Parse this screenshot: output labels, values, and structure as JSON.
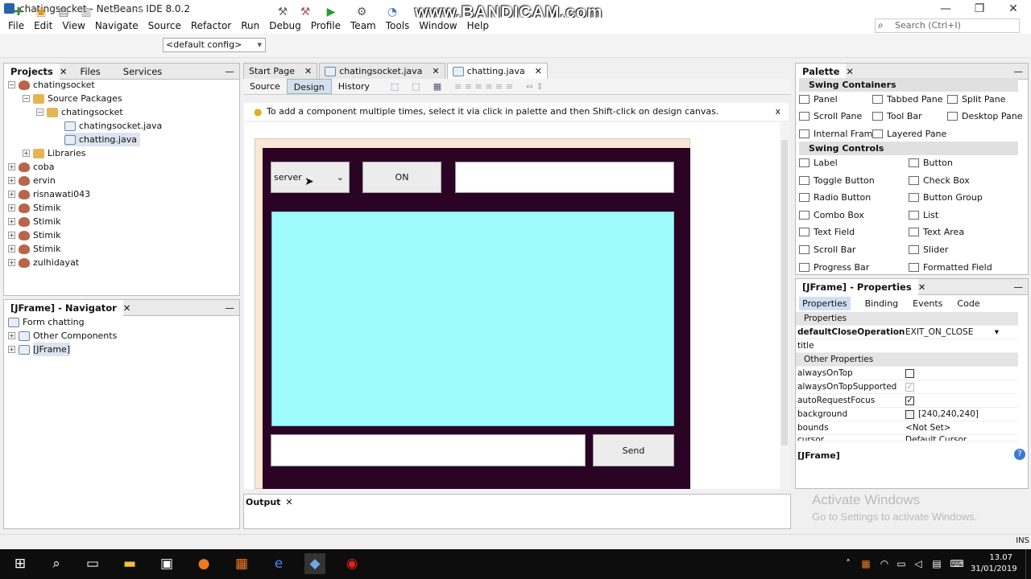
{
  "window": {
    "title": "chatingsocket - NetBeans IDE 8.0.2",
    "watermark": "www.BANDICAM.com"
  },
  "menu": [
    "File",
    "Edit",
    "View",
    "Navigate",
    "Source",
    "Refactor",
    "Run",
    "Debug",
    "Profile",
    "Team",
    "Tools",
    "Window",
    "Help"
  ],
  "toolbar": {
    "config": "<default config>",
    "search_placeholder": "Search (Ctrl+I)"
  },
  "projects": {
    "tabs": [
      "Projects",
      "Files",
      "Services"
    ],
    "tree": [
      "chatingsocket",
      "Source Packages",
      "chatingsocket",
      "chatingsocket.java",
      "chatting.java",
      "Libraries",
      "coba",
      "ervin",
      "risnawati043",
      "Stimik",
      "Stimik",
      "Stimik",
      "Stimik",
      "zulhidayat"
    ]
  },
  "navigator": {
    "title": "[JFrame] - Navigator",
    "tree": [
      "Form chatting",
      "Other Components",
      "[JFrame]"
    ]
  },
  "editor": {
    "tabs": [
      "Start Page",
      "chatingsocket.java",
      "chatting.java"
    ],
    "modes": [
      "Source",
      "Design",
      "History"
    ],
    "hint": "To add a component multiple times, select it via click in palette and then Shift-click on design canvas.",
    "hint_close": "x",
    "form": {
      "combo_value": "server",
      "on_button": "ON",
      "send_button": "Send"
    },
    "colors": {
      "frame_bg": "#2a0325",
      "textarea_bg": "#9efcfc"
    }
  },
  "output": {
    "title": "Output"
  },
  "palette": {
    "title": "Palette",
    "sections": {
      "containers": {
        "label": "Swing Containers",
        "items": [
          "Panel",
          "Tabbed Pane",
          "Split Pane",
          "Scroll Pane",
          "Tool Bar",
          "Desktop Pane",
          "Internal Frame",
          "Layered Pane"
        ]
      },
      "controls": {
        "label": "Swing Controls",
        "items": [
          "Label",
          "Button",
          "Toggle Button",
          "Check Box",
          "Radio Button",
          "Button Group",
          "Combo Box",
          "List",
          "Text Field",
          "Text Area",
          "Scroll Bar",
          "Slider",
          "Progress Bar",
          "Formatted Field"
        ]
      }
    }
  },
  "properties": {
    "title": "[JFrame] - Properties",
    "tabs": [
      "Properties",
      "Binding",
      "Events",
      "Code"
    ],
    "section_properties": "Properties",
    "section_other": "Other Properties",
    "rows": {
      "defaultCloseOperation": {
        "key": "defaultCloseOperation",
        "value": "EXIT_ON_CLOSE"
      },
      "title": {
        "key": "title",
        "value": ""
      },
      "alwaysOnTop": {
        "key": "alwaysOnTop",
        "value": ""
      },
      "alwaysOnTopSupported": {
        "key": "alwaysOnTopSupported",
        "value": "✓"
      },
      "autoRequestFocus": {
        "key": "autoRequestFocus",
        "value": "✓"
      },
      "background": {
        "key": "background",
        "value": "[240,240,240]"
      },
      "bounds": {
        "key": "bounds",
        "value": "<Not Set>"
      },
      "cursor": {
        "key": "cursor",
        "value": "Default Cursor"
      }
    },
    "footer": "[JFrame]"
  },
  "activation": {
    "line1": "Activate Windows",
    "line2": "Go to Settings to activate Windows."
  },
  "statusbar": {
    "mode": "INS"
  },
  "taskbar": {
    "time": "13.07",
    "date": "31/01/2019"
  }
}
